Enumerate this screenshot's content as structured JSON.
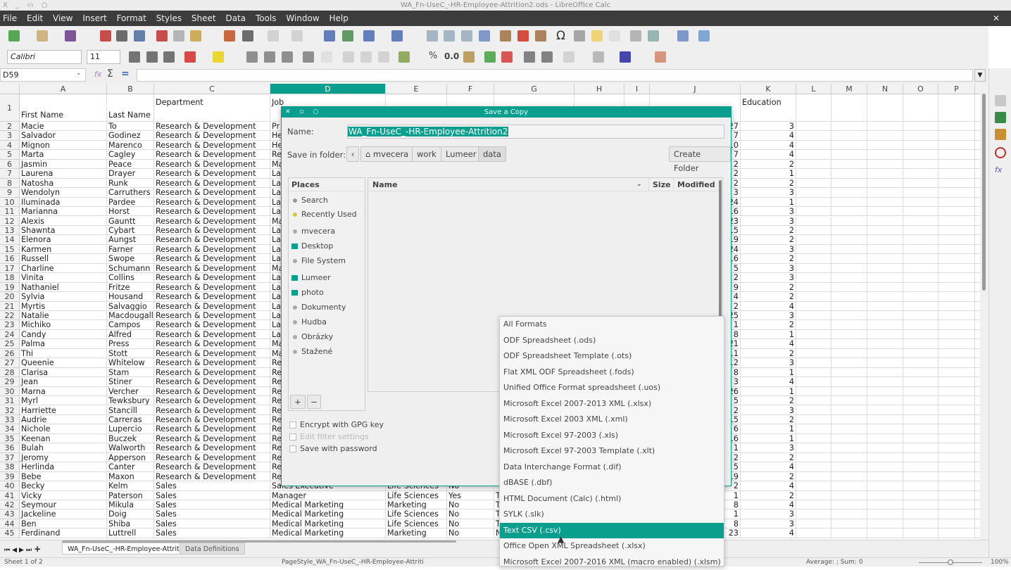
{
  "window": {
    "title": "WA_Fn-UseC_-HR-Employee-Attrition2.ods - LibreOffice Calc",
    "controls": "X _ ▭ ○"
  },
  "menu": [
    "File",
    "Edit",
    "View",
    "Insert",
    "Format",
    "Styles",
    "Sheet",
    "Data",
    "Tools",
    "Window",
    "Help"
  ],
  "menu_close": "✕",
  "toolbar": {
    "font_name": "Calibri",
    "font_size": "11",
    "percent": "%",
    "decimal": "0.0"
  },
  "formula_bar": {
    "cell_ref": "D59",
    "sigma": "Σ",
    "equals": "=",
    "value": ""
  },
  "sheet": {
    "columns": [
      "A",
      "B",
      "C",
      "D",
      "E",
      "F",
      "G",
      "H",
      "I",
      "J",
      "K",
      "L",
      "M",
      "N",
      "O",
      "P"
    ],
    "selected_column": "D",
    "header_row": {
      "A": "First Name",
      "B": "Last Name",
      "C": "Department",
      "D": "Job",
      "K": "Education"
    },
    "rows": [
      [
        "Macie",
        "To",
        "Research & Development",
        "Pr",
        "",
        "",
        "",
        "27",
        "3"
      ],
      [
        "Salvador",
        "Godinez",
        "Research & Development",
        "He",
        "",
        "",
        "",
        "7",
        "4"
      ],
      [
        "Mignon",
        "Marenco",
        "Research & Development",
        "He",
        "",
        "",
        "",
        "10",
        "4"
      ],
      [
        "Marta",
        "Cagley",
        "Research & Development",
        "Re",
        "",
        "",
        "",
        "7",
        "4"
      ],
      [
        "Jasmin",
        "Peace",
        "Research & Development",
        "Ma",
        "",
        "",
        "",
        "2",
        "2"
      ],
      [
        "Laurena",
        "Drayer",
        "Research & Development",
        "La",
        "",
        "",
        "",
        "2",
        "1"
      ],
      [
        "Natosha",
        "Runk",
        "Research & Development",
        "La",
        "",
        "",
        "",
        "2",
        "2"
      ],
      [
        "Wendolyn",
        "Carruthers",
        "Research & Development",
        "La",
        "",
        "",
        "",
        "3",
        "3"
      ],
      [
        "Iluminada",
        "Pardee",
        "Research & Development",
        "La",
        "",
        "",
        "",
        "24",
        "1"
      ],
      [
        "Marianna",
        "Horst",
        "Research & Development",
        "La",
        "",
        "",
        "",
        "16",
        "3"
      ],
      [
        "Alexis",
        "Gauntt",
        "Research & Development",
        "Ma",
        "",
        "",
        "",
        "23",
        "3"
      ],
      [
        "Shawnta",
        "Cybart",
        "Research & Development",
        "La",
        "",
        "",
        "",
        "15",
        "2"
      ],
      [
        "Elenora",
        "Aungst",
        "Research & Development",
        "La",
        "",
        "",
        "",
        "19",
        "2"
      ],
      [
        "Karmen",
        "Farner",
        "Research & Development",
        "La",
        "",
        "",
        "",
        "24",
        "3"
      ],
      [
        "Russell",
        "Swope",
        "Research & Development",
        "La",
        "",
        "",
        "",
        "16",
        "2"
      ],
      [
        "Charline",
        "Schumann",
        "Research & Development",
        "Ma",
        "",
        "",
        "",
        "5",
        "3"
      ],
      [
        "Vinita",
        "Collins",
        "Research & Development",
        "La",
        "",
        "",
        "",
        "2",
        "3"
      ],
      [
        "Nathaniel",
        "Fritze",
        "Research & Development",
        "La",
        "",
        "",
        "",
        "9",
        "2"
      ],
      [
        "Sylvia",
        "Housand",
        "Research & Development",
        "La",
        "",
        "",
        "",
        "4",
        "2"
      ],
      [
        "Myrtis",
        "Salvaggio",
        "Research & Development",
        "La",
        "",
        "",
        "",
        "2",
        "4"
      ],
      [
        "Natalie",
        "Macdougall",
        "Research & Development",
        "La",
        "",
        "",
        "",
        "25",
        "3"
      ],
      [
        "Michiko",
        "Campos",
        "Research & Development",
        "La",
        "",
        "",
        "",
        "1",
        "2"
      ],
      [
        "Candy",
        "Alfred",
        "Research & Development",
        "La",
        "",
        "",
        "",
        "8",
        "1"
      ],
      [
        "Palma",
        "Press",
        "Research & Development",
        "Ma",
        "",
        "",
        "",
        "21",
        "4"
      ],
      [
        "Thi",
        "Stott",
        "Research & Development",
        "Ma",
        "",
        "",
        "",
        "11",
        "2"
      ],
      [
        "Queenie",
        "Whitelow",
        "Research & Development",
        "Re",
        "",
        "",
        "",
        "12",
        "3"
      ],
      [
        "Clarisa",
        "Stam",
        "Research & Development",
        "Re",
        "",
        "",
        "",
        "8",
        "1"
      ],
      [
        "Jean",
        "Stiner",
        "Research & Development",
        "Re",
        "",
        "",
        "",
        "3",
        "4"
      ],
      [
        "Marna",
        "Vercher",
        "Research & Development",
        "Re",
        "",
        "",
        "",
        "26",
        "1"
      ],
      [
        "Myrl",
        "Tewksbury",
        "Research & Development",
        "Re",
        "",
        "",
        "",
        "5",
        "2"
      ],
      [
        "Harriette",
        "Stancill",
        "Research & Development",
        "Re",
        "",
        "",
        "",
        "2",
        "3"
      ],
      [
        "Audrie",
        "Carreras",
        "Research & Development",
        "Re",
        "",
        "",
        "",
        "15",
        "2"
      ],
      [
        "Nichole",
        "Lupercio",
        "Research & Development",
        "Re",
        "",
        "",
        "",
        "6",
        "1"
      ],
      [
        "Keenan",
        "Buczek",
        "Research & Development",
        "Re",
        "",
        "",
        "",
        "16",
        "1"
      ],
      [
        "Bulah",
        "Walworth",
        "Research & Development",
        "Re",
        "",
        "",
        "",
        "1",
        "3"
      ],
      [
        "Jeromy",
        "Apperson",
        "Research & Development",
        "Re",
        "",
        "",
        "",
        "2",
        "2"
      ],
      [
        "Herlinda",
        "Canter",
        "Research & Development",
        "Re",
        "",
        "",
        "",
        "5",
        "4"
      ],
      [
        "Bebe",
        "Maxon",
        "Research & Development",
        "Re",
        "",
        "",
        "",
        "19",
        "2"
      ],
      [
        "Becky",
        "Kelm",
        "Sales",
        "Sales Executive",
        "Life Sciences",
        "No",
        "",
        "2",
        "4"
      ],
      [
        "Vicky",
        "Paterson",
        "Sales",
        "Manager",
        "Life Sciences",
        "Yes",
        "T",
        "1",
        "2"
      ],
      [
        "Seymour",
        "Mikula",
        "Sales",
        "Medical Marketing",
        "Marketing",
        "No",
        "T",
        "8",
        "4"
      ],
      [
        "Jackeline",
        "Doig",
        "Sales",
        "Medical Marketing",
        "Life Sciences",
        "No",
        "T",
        "1",
        "3"
      ],
      [
        "Ben",
        "Shiba",
        "Sales",
        "Medical Marketing",
        "Life Sciences",
        "No",
        "T",
        "8",
        "3"
      ],
      [
        "Ferdinand",
        "Luttrell",
        "Sales",
        "Medical Marketing",
        "Marketing",
        "No",
        "N",
        "23",
        "4"
      ]
    ]
  },
  "sheet_tabs": {
    "nav": [
      "⏮",
      "◀",
      "▶",
      "⏭",
      "+"
    ],
    "tabs": [
      "WA_Fn-UseC_-HR-Employee-Attriti",
      "Data Definitions"
    ],
    "active": 0
  },
  "status": {
    "sheet": "Sheet 1 of 2",
    "page_style": "PageStyle_WA_Fn-UseC_-HR-Employee-Attriti",
    "summary": "Average: ; Sum: 0",
    "zoom": "100%",
    "zoom_level": 100
  },
  "dialog": {
    "title": "Save a Copy",
    "name_label": "Name:",
    "name_value": "WA_Fn-UseC_-HR-Employee-Attrition2",
    "folder_label": "Save in folder:",
    "path": [
      "mvecera",
      "work",
      "Lumeer",
      "data"
    ],
    "create_folder": "Create Folder",
    "places_header": "Places",
    "places": [
      {
        "label": "Search",
        "icon": "search-icon"
      },
      {
        "label": "Recently Used",
        "icon": "clock-icon"
      },
      {
        "label": "mvecera",
        "icon": "home-icon"
      },
      {
        "label": "Desktop",
        "icon": "folder-icon"
      },
      {
        "label": "File System",
        "icon": "drive-icon"
      },
      {
        "label": "Lumeer",
        "icon": "folder-icon"
      },
      {
        "label": "photo",
        "icon": "folder-icon"
      },
      {
        "label": "Dokumenty",
        "icon": "document-icon"
      },
      {
        "label": "Hudba",
        "icon": "music-icon"
      },
      {
        "label": "Obrázky",
        "icon": "image-icon"
      },
      {
        "label": "Stažené",
        "icon": "download-icon"
      }
    ],
    "columns": {
      "name": "Name",
      "size": "Size",
      "modified": "Modified"
    },
    "add": "+",
    "remove": "−",
    "options": [
      {
        "label": "Encrypt with GPG key",
        "enabled": true,
        "checked": false
      },
      {
        "label": "Edit filter settings",
        "enabled": false,
        "checked": false
      },
      {
        "label": "Save with password",
        "enabled": true,
        "checked": false
      }
    ]
  },
  "file_types": {
    "selected": "Text CSV (.csv)",
    "options": [
      "All Formats",
      "ODF Spreadsheet (.ods)",
      "ODF Spreadsheet Template (.ots)",
      "Flat XML ODF Spreadsheet (.fods)",
      "Unified Office Format spreadsheet (.uos)",
      "Microsoft Excel 2007-2013 XML (.xlsx)",
      "Microsoft Excel 2003 XML (.xml)",
      "Microsoft Excel 97-2003 (.xls)",
      "Microsoft Excel 97-2003 Template (.xlt)",
      "Data Interchange Format (.dif)",
      "dBASE (.dbf)",
      "HTML Document (Calc) (.html)",
      "SYLK (.slk)",
      "Text CSV (.csv)",
      "Office Open XML Spreadsheet (.xlsx)",
      "Microsoft Excel 2007-2016 XML (macro enabled) (.xlsm)"
    ]
  },
  "colors": {
    "accent": "#0a9e8e",
    "menubar": "#3c3c3c"
  }
}
